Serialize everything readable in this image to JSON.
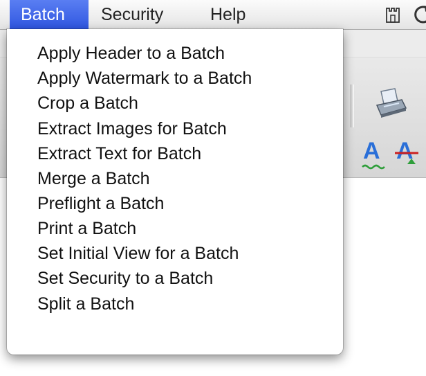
{
  "menubar": {
    "items": [
      {
        "label": "Batch",
        "active": true
      },
      {
        "label": "Security",
        "active": false
      },
      {
        "label": "Help",
        "active": false
      }
    ]
  },
  "batch_menu": {
    "items": [
      {
        "label": "Apply Header to a Batch"
      },
      {
        "label": "Apply Watermark to a Batch"
      },
      {
        "label": "Crop a Batch"
      },
      {
        "label": "Extract Images for Batch"
      },
      {
        "label": "Extract Text for Batch"
      },
      {
        "label": "Merge a Batch"
      },
      {
        "label": "Preflight a Batch"
      },
      {
        "label": "Print a Batch"
      },
      {
        "label": "Set Initial View for a Batch"
      },
      {
        "label": "Set Security to a Batch"
      },
      {
        "label": "Split a Batch"
      }
    ]
  },
  "toolbar": {
    "icons": [
      {
        "name": "scanner-icon"
      },
      {
        "name": "text-underline-icon",
        "glyph": "A"
      },
      {
        "name": "text-strikethrough-icon",
        "glyph": "A"
      }
    ]
  },
  "colors": {
    "menu_highlight": "#3a62e6",
    "menu_text": "#111111",
    "glyph_blue": "#2a6fd8",
    "underline_green": "#2e9e3a",
    "strike_red": "#cc2020"
  }
}
